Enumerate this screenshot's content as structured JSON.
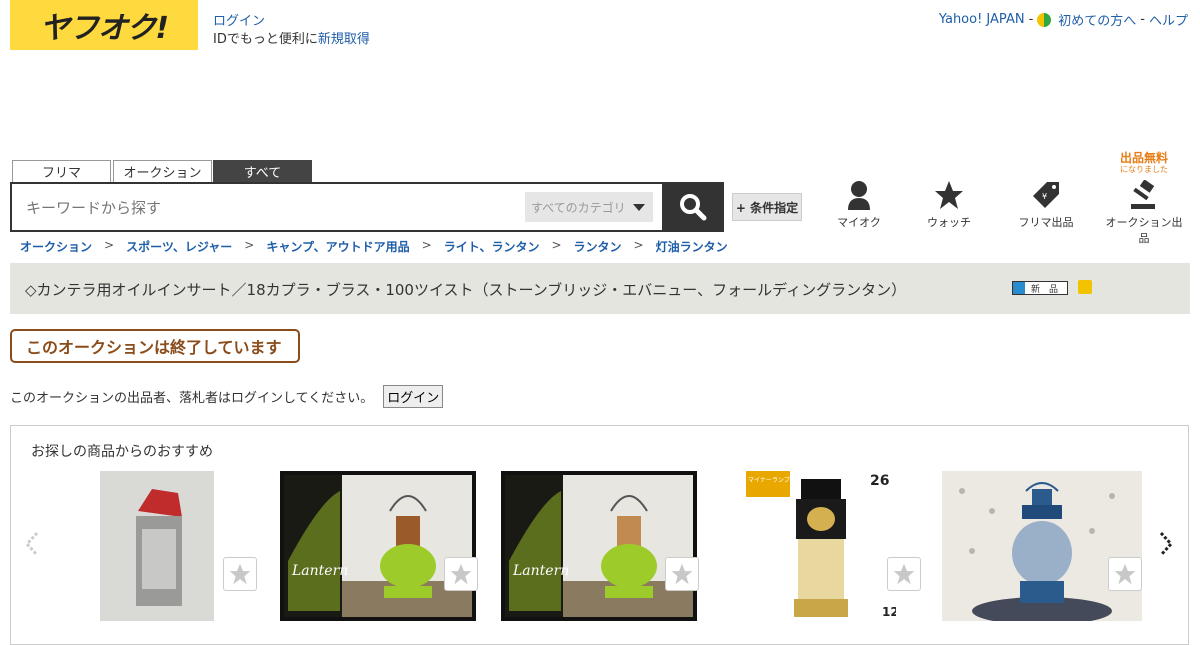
{
  "header": {
    "logo_text": "ヤフオク!",
    "login_link": "ログイン",
    "login_sub_prefix": "IDでもっと便利に",
    "signup_link": "新規取得",
    "top_links": {
      "yahoo_japan": "Yahoo! JAPAN",
      "sep1": "-",
      "beginner": "初めての方へ",
      "sep2": "-",
      "help": "ヘルプ"
    }
  },
  "search": {
    "tabs": [
      {
        "label": "フリマ"
      },
      {
        "label": "オークション"
      },
      {
        "label": "すべて",
        "active": true
      }
    ],
    "placeholder": "キーワードから探す",
    "category_label": "すべてのカテゴリ",
    "condition_label": "+ 条件指定"
  },
  "nav": {
    "free_badge_main": "出品無料",
    "free_badge_sub": "になりました",
    "items": [
      {
        "label": "マイオク",
        "icon": "person-icon"
      },
      {
        "label": "ウォッチ",
        "icon": "star-icon"
      },
      {
        "label": "フリマ出品",
        "icon": "price-tag-icon"
      },
      {
        "label": "オークション出品",
        "icon": "gavel-icon"
      }
    ]
  },
  "breadcrumb": [
    "オークション",
    "スポーツ、レジャー",
    "キャンプ、アウトドア用品",
    "ライト、ランタン",
    "ランタン",
    "灯油ランタン"
  ],
  "breadcrumb_sep": ">",
  "item": {
    "title": "◇カンテラ用オイルインサート／18カプラ・ブラス・100ツイスト（ストーンブリッジ・エバニュー、フォールディングランタン）",
    "new_badge": "新　品"
  },
  "status": {
    "ended_text": "このオークションは終了しています",
    "login_message": "このオークションの出品者、落札者はログインしてください。",
    "login_button": "ログイン"
  },
  "recommend": {
    "title": "お探しの商品からのおすすめ",
    "products": [
      {
        "label": "",
        "tone": "#a8a8a8"
      },
      {
        "label": "Lantern",
        "tone": "#9dcb2a"
      },
      {
        "label": "Lantern",
        "tone": "#9dcb2a"
      },
      {
        "label": "マイナーランプ ヨットランプ",
        "height": "26",
        "size": "12"
      },
      {
        "label": "",
        "tone": "#2b5a8c"
      }
    ],
    "colors": {
      "brand": "#ffda3e",
      "link": "#1f5ea8",
      "accent": "#e87d17"
    }
  }
}
